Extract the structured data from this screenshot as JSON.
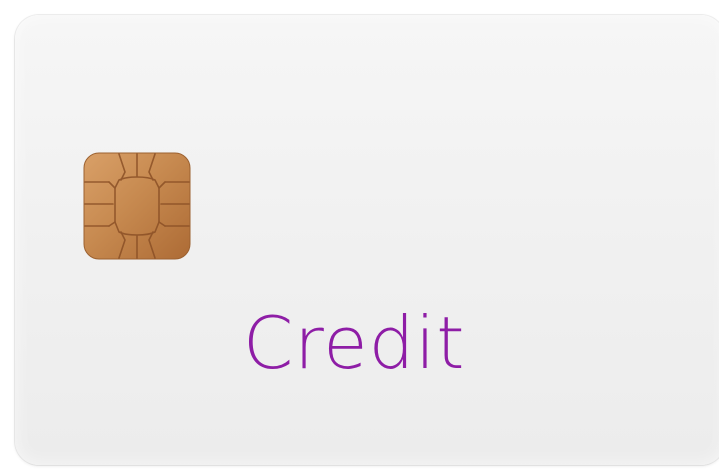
{
  "card": {
    "label": "Credit",
    "label_color": "#8e1da6",
    "chip_icon": "emv-chip-icon",
    "background_color": "#f2f2f2"
  }
}
